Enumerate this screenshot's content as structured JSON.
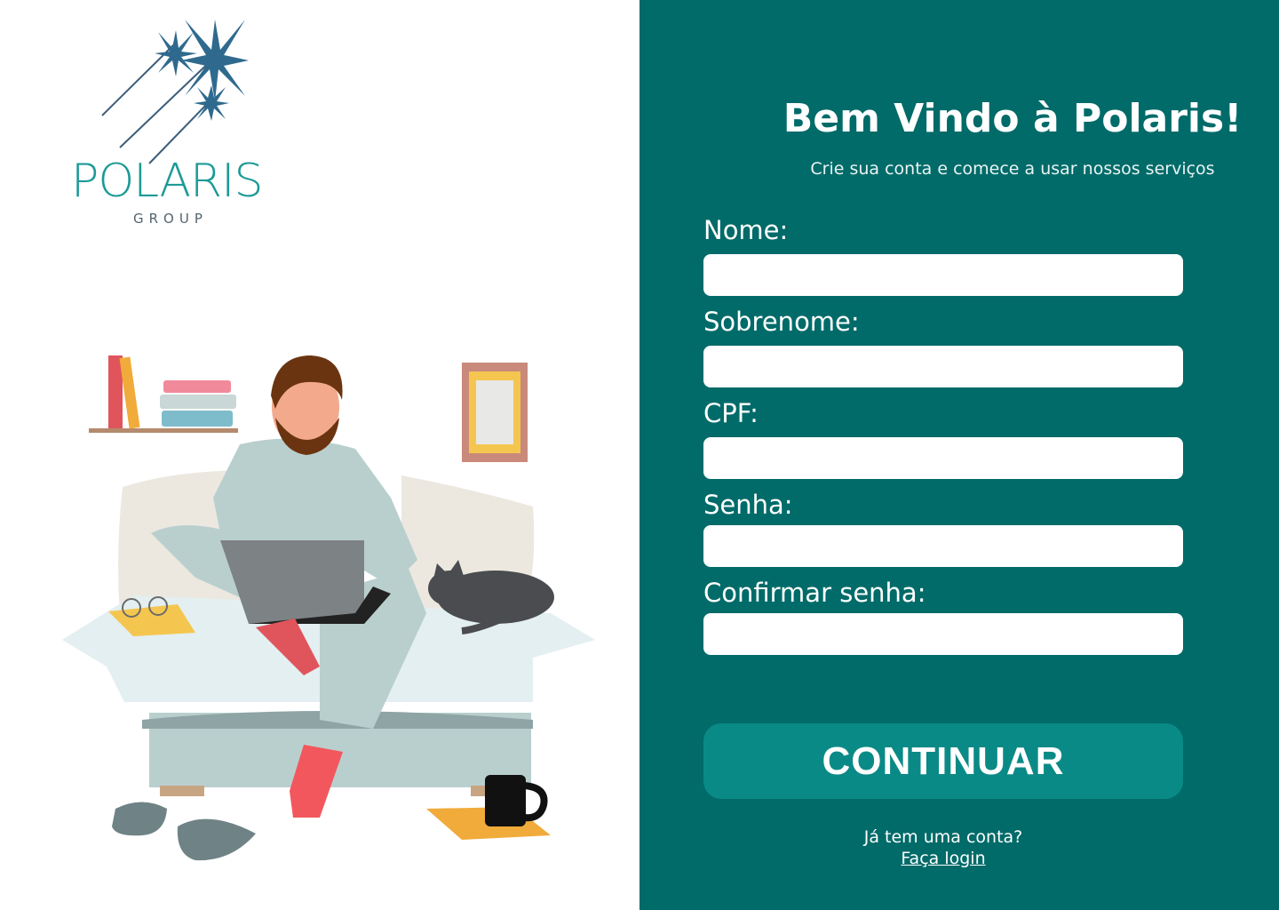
{
  "brand": {
    "name": "POLARIS",
    "sub": "GROUP",
    "color": "#1c9a97"
  },
  "colors": {
    "panel": "#006b69",
    "button": "#0a8a86"
  },
  "form": {
    "title": "Bem Vindo à Polaris!",
    "subtitle": "Crie sua conta e comece a usar nossos serviços",
    "fields": [
      {
        "label": "Nome:",
        "value": ""
      },
      {
        "label": "Sobrenome:",
        "value": ""
      },
      {
        "label": "CPF:",
        "value": ""
      },
      {
        "label": "Senha:",
        "value": ""
      },
      {
        "label": "Confirmar senha:",
        "value": ""
      }
    ],
    "submit_label": "CONTINUAR",
    "have_account": "Já tem uma conta?",
    "login_link": "Faça login"
  }
}
